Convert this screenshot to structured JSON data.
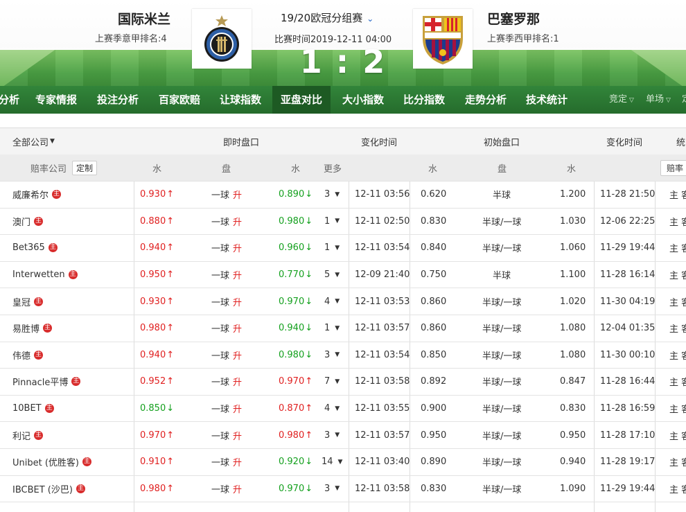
{
  "match": {
    "home_name": "国际米兰",
    "home_rank": "上赛季意甲排名:4",
    "away_name": "巴塞罗那",
    "away_rank": "上赛季西甲排名:1",
    "league": "19/20欧冠分组赛",
    "time": "比赛时间2019-12-11 04:00",
    "score": "1 : 2"
  },
  "nav": {
    "items": [
      "分析",
      "专家情报",
      "投注分析",
      "百家欧赔",
      "让球指数",
      "亚盘对比",
      "大小指数",
      "比分指数",
      "走势分析",
      "技术统计"
    ],
    "active": "亚盘对比",
    "selects": [
      "竞定",
      "单场"
    ]
  },
  "table": {
    "header1": {
      "company_filter": "全部公司",
      "live": "即时盘口",
      "change_time": "变化时间",
      "initial": "初始盘口",
      "change_time2": "变化时间",
      "stats": "统"
    },
    "header2": {
      "company": "赔率公司",
      "custom": "定制",
      "water1": "水",
      "pan": "盘",
      "water2": "水",
      "more": "更多",
      "water3": "水",
      "pan2": "盘",
      "water4": "水",
      "peilv": "赔率"
    },
    "host_badge": "主",
    "hk": "主 客",
    "rows": [
      {
        "company": "威廉希尔",
        "w1": "0.930",
        "w1d": "up",
        "pan": "一球",
        "sheng": "升",
        "w2": "0.890",
        "w2d": "down",
        "more": "3",
        "time": "12-11 03:56",
        "iw1": "0.620",
        "ipan": "半球",
        "iw2": "1.200",
        "itime": "11-28 21:50"
      },
      {
        "company": "澳门",
        "w1": "0.880",
        "w1d": "up",
        "pan": "一球",
        "sheng": "升",
        "w2": "0.980",
        "w2d": "down",
        "more": "1",
        "time": "12-11 02:50",
        "iw1": "0.830",
        "ipan": "半球/一球",
        "iw2": "1.030",
        "itime": "12-06 22:25"
      },
      {
        "company": "Bet365",
        "w1": "0.940",
        "w1d": "up",
        "pan": "一球",
        "sheng": "升",
        "w2": "0.960",
        "w2d": "down",
        "more": "1",
        "time": "12-11 03:54",
        "iw1": "0.840",
        "ipan": "半球/一球",
        "iw2": "1.060",
        "itime": "11-29 19:44"
      },
      {
        "company": "Interwetten",
        "w1": "0.950",
        "w1d": "up",
        "pan": "一球",
        "sheng": "升",
        "w2": "0.770",
        "w2d": "down",
        "more": "5",
        "time": "12-09 21:40",
        "iw1": "0.750",
        "ipan": "半球",
        "iw2": "1.100",
        "itime": "11-28 16:14"
      },
      {
        "company": "皇冠",
        "w1": "0.930",
        "w1d": "up",
        "pan": "一球",
        "sheng": "升",
        "w2": "0.970",
        "w2d": "down",
        "more": "4",
        "time": "12-11 03:53",
        "iw1": "0.860",
        "ipan": "半球/一球",
        "iw2": "1.020",
        "itime": "11-30 04:19"
      },
      {
        "company": "易胜博",
        "w1": "0.980",
        "w1d": "up",
        "pan": "一球",
        "sheng": "升",
        "w2": "0.940",
        "w2d": "down",
        "more": "1",
        "time": "12-11 03:57",
        "iw1": "0.860",
        "ipan": "半球/一球",
        "iw2": "1.080",
        "itime": "12-04 01:35"
      },
      {
        "company": "伟德",
        "w1": "0.940",
        "w1d": "up",
        "pan": "一球",
        "sheng": "升",
        "w2": "0.980",
        "w2d": "down",
        "more": "3",
        "time": "12-11 03:54",
        "iw1": "0.850",
        "ipan": "半球/一球",
        "iw2": "1.080",
        "itime": "11-30 00:10"
      },
      {
        "company": "Pinnacle平博",
        "w1": "0.952",
        "w1d": "up",
        "pan": "一球",
        "sheng": "升",
        "w2": "0.970",
        "w2d": "up",
        "more": "7",
        "time": "12-11 03:58",
        "iw1": "0.892",
        "ipan": "半球/一球",
        "iw2": "0.847",
        "itime": "11-28 16:44"
      },
      {
        "company": "10BET",
        "w1": "0.850",
        "w1d": "down",
        "pan": "一球",
        "sheng": "升",
        "w2": "0.870",
        "w2d": "up",
        "more": "4",
        "time": "12-11 03:55",
        "iw1": "0.900",
        "ipan": "半球/一球",
        "iw2": "0.830",
        "itime": "11-28 16:59"
      },
      {
        "company": "利记",
        "w1": "0.970",
        "w1d": "up",
        "pan": "一球",
        "sheng": "升",
        "w2": "0.980",
        "w2d": "up",
        "more": "3",
        "time": "12-11 03:57",
        "iw1": "0.950",
        "ipan": "半球/一球",
        "iw2": "0.950",
        "itime": "11-28 17:10"
      },
      {
        "company": "Unibet (优胜客)",
        "w1": "0.910",
        "w1d": "up",
        "pan": "一球",
        "sheng": "升",
        "w2": "0.920",
        "w2d": "down",
        "more": "14",
        "time": "12-11 03:40",
        "iw1": "0.890",
        "ipan": "半球/一球",
        "iw2": "0.940",
        "itime": "11-28 19:17"
      },
      {
        "company": "IBCBET (沙巴)",
        "w1": "0.980",
        "w1d": "up",
        "pan": "一球",
        "sheng": "升",
        "w2": "0.970",
        "w2d": "down",
        "more": "3",
        "time": "12-11 03:58",
        "iw1": "0.830",
        "ipan": "半球/一球",
        "iw2": "1.090",
        "itime": "11-29 19:44"
      }
    ]
  },
  "colors": {
    "up": "#e02020",
    "down": "#14a01e",
    "nav_bg": "#2b7a33",
    "nav_active": "#1d5a23",
    "pitch": "#4aa043"
  }
}
